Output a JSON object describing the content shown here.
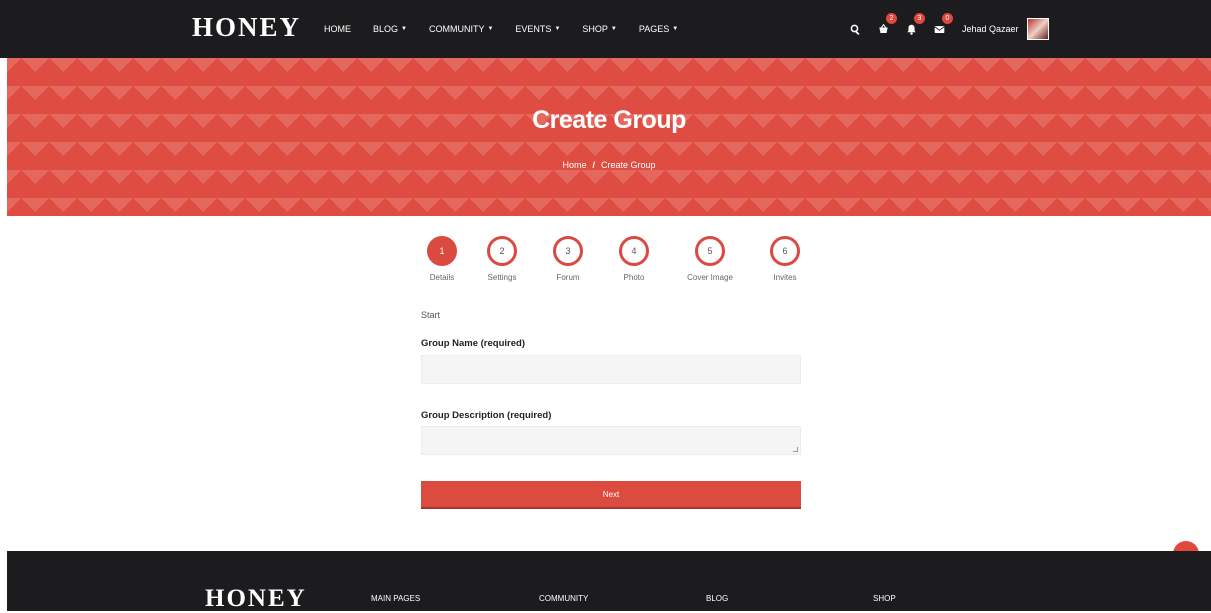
{
  "navbar": {
    "logo": "HONEY",
    "links": [
      {
        "label": "HOME",
        "dropdown": false
      },
      {
        "label": "BLOG",
        "dropdown": true
      },
      {
        "label": "COMMUNITY",
        "dropdown": true
      },
      {
        "label": "EVENTS",
        "dropdown": true
      },
      {
        "label": "SHOP",
        "dropdown": true
      },
      {
        "label": "PAGES",
        "dropdown": true
      }
    ],
    "cart_count": "2",
    "notifications_count": "3",
    "messages_count": "0",
    "username": "Jehad Qazaer"
  },
  "hero": {
    "title": "Create Group",
    "breadcrumb": {
      "home": "Home",
      "separator": "/",
      "current": "Create Group"
    }
  },
  "steps": [
    {
      "number": "1",
      "label": "Details",
      "active": true
    },
    {
      "number": "2",
      "label": "Settings",
      "active": false
    },
    {
      "number": "3",
      "label": "Forum",
      "active": false
    },
    {
      "number": "4",
      "label": "Photo",
      "active": false
    },
    {
      "number": "5",
      "label": "Cover Image",
      "active": false
    },
    {
      "number": "6",
      "label": "Invites",
      "active": false
    }
  ],
  "form": {
    "start_label": "Start",
    "group_name_label": "Group Name (required)",
    "group_name_value": "",
    "group_description_label": "Group Description (required)",
    "group_description_value": "",
    "next_label": "Next"
  },
  "footer": {
    "logo": "HONEY",
    "columns": [
      "MAIN PAGES",
      "COMMUNITY",
      "BLOG",
      "SHOP"
    ]
  },
  "colors": {
    "accent": "#dc4b40",
    "dark": "#1c1c1e"
  },
  "icons": [
    "search-icon",
    "cart-icon",
    "bell-icon",
    "envelope-icon",
    "arrow-up-icon"
  ]
}
